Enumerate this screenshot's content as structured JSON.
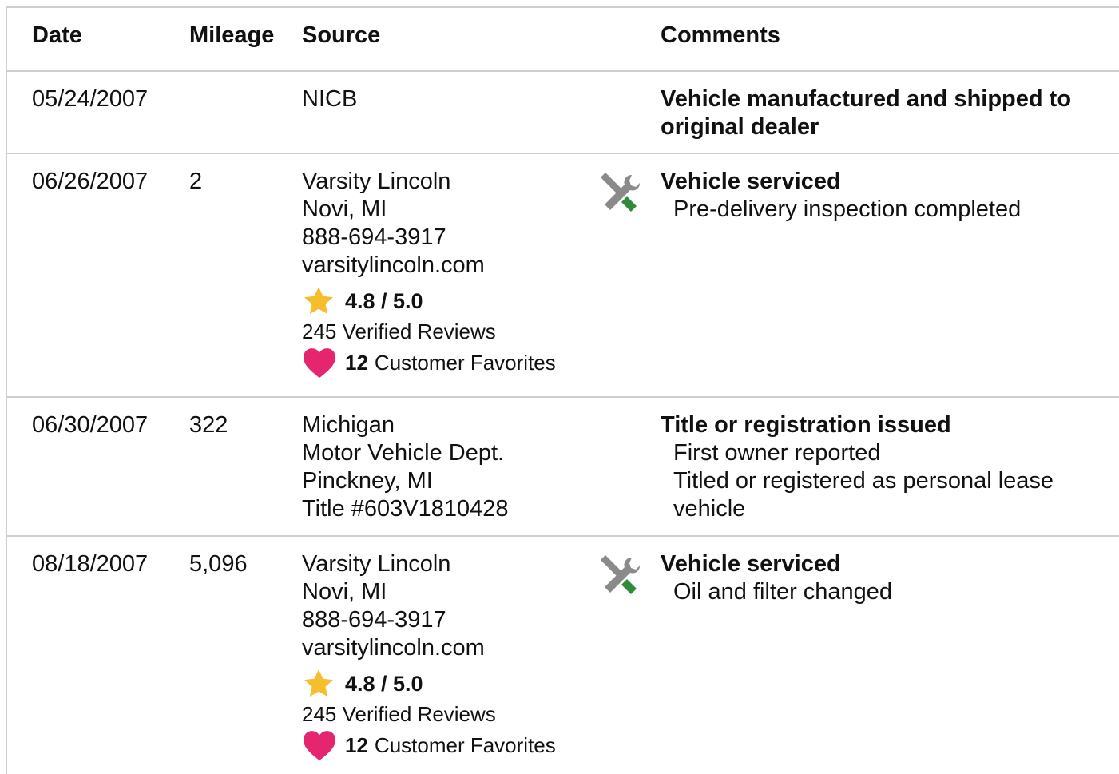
{
  "header": {
    "date": "Date",
    "mileage": "Mileage",
    "source": "Source",
    "comments": "Comments"
  },
  "colors": {
    "border": "#cfcfcf",
    "star": "#f6be2c",
    "heart": "#e5266f",
    "wrench_green": "#2e8b3a",
    "tool_gray": "#8a8a8a"
  },
  "icons": {
    "service": "wrench-screwdriver-icon",
    "rating": "star-icon",
    "favorites": "heart-icon"
  },
  "rows": [
    {
      "date": "05/24/2007",
      "mileage": "",
      "source": [
        "NICB"
      ],
      "comment_title": "Vehicle manufactured and shipped to original dealer",
      "comment_title_lines": [
        "Vehicle manufactured and shipped to",
        "original dealer"
      ],
      "details": []
    },
    {
      "date": "06/26/2007",
      "mileage": "2",
      "source": [
        "Varsity Lincoln",
        "Novi, MI",
        "888-694-3917",
        "varsitylincoln.com"
      ],
      "rating": "4.8 / 5.0",
      "reviews": "245 Verified Reviews",
      "favorites_count": "12",
      "favorites_label": "Customer Favorites",
      "comment_title": "Vehicle serviced",
      "details": [
        "Pre-delivery inspection completed"
      ]
    },
    {
      "date": "06/30/2007",
      "mileage": "322",
      "source": [
        "Michigan",
        "Motor Vehicle Dept.",
        "Pinckney, MI",
        "Title #603V1810428"
      ],
      "comment_title": "Title or registration issued",
      "details": [
        "First owner reported",
        "Titled or registered as personal lease",
        "vehicle"
      ]
    },
    {
      "date": "08/18/2007",
      "mileage": "5,096",
      "source": [
        "Varsity Lincoln",
        "Novi, MI",
        "888-694-3917",
        "varsitylincoln.com"
      ],
      "rating": "4.8 / 5.0",
      "reviews": "245 Verified Reviews",
      "favorites_count": "12",
      "favorites_label": "Customer Favorites",
      "comment_title": "Vehicle serviced",
      "details": [
        "Oil and filter changed"
      ]
    }
  ]
}
